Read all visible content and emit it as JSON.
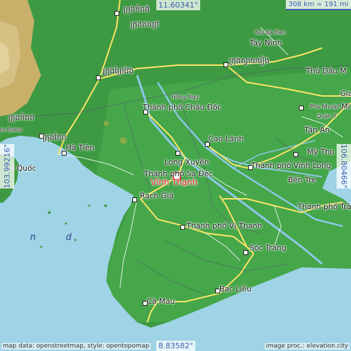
{
  "map": {
    "coords": {
      "top": "11.60341°",
      "bottom": "8.83582°",
      "left": "103.99216°",
      "right": "106.80466°"
    },
    "scale": "308 km = 191 mi",
    "highlight": "Vĩnh Thạnh",
    "places": {
      "tay_ninh": "Tây Ninh",
      "nui_ba_den": "Núi Bà Đen",
      "thu_dau_mot": "Thủ Dầu M",
      "phu_nhuan": "Phú Nhuận",
      "quan7": "Quận 7",
      "tan_an": "Tân An",
      "my_tho": "Mỹ Tho",
      "cao_lanh": "Cao Lãnh",
      "long_xuyen": "Long Xuyên",
      "sa_dec": "Thành phố Sa Đéc",
      "vinh_long": "Thành phố Vĩnh Long",
      "ben_tre": "Bến Tre",
      "tra_vinh": "Thành phố Trà",
      "chau_doc": "Thành phố Châu Đốc",
      "hong_ngu": "Hồng Ngự",
      "ha_tien": "Hà Tiên",
      "phu_quoc": "ú Quốc",
      "rach_gia": "Rạch Giá",
      "vi_thanh": "Thành phố Vị Thanh",
      "soc_trang": "Sóc Trăng",
      "bac_lieu": "Bạc Liêu",
      "ca_mau": "Cà Mau",
      "bokor": "m Bokor",
      "gia": "Gia",
      "mi": "Mi",
      "sea_n": "n",
      "sea_d": "d",
      "kh1": "ក្រុងកំពង់",
      "kh2": "ក្រុងតាខ្មៅ",
      "kh3": "ក្រុងកំពត",
      "kh4": "ក្រុងព្រៃវែង",
      "kh5": "ក្រុងស្វាយរៀង",
      "kh6": "ក្រុងកែប"
    },
    "credit_left": "map data: openstreetmap, style: opentopomap",
    "credit_right": "image proc.: elevation.city"
  }
}
